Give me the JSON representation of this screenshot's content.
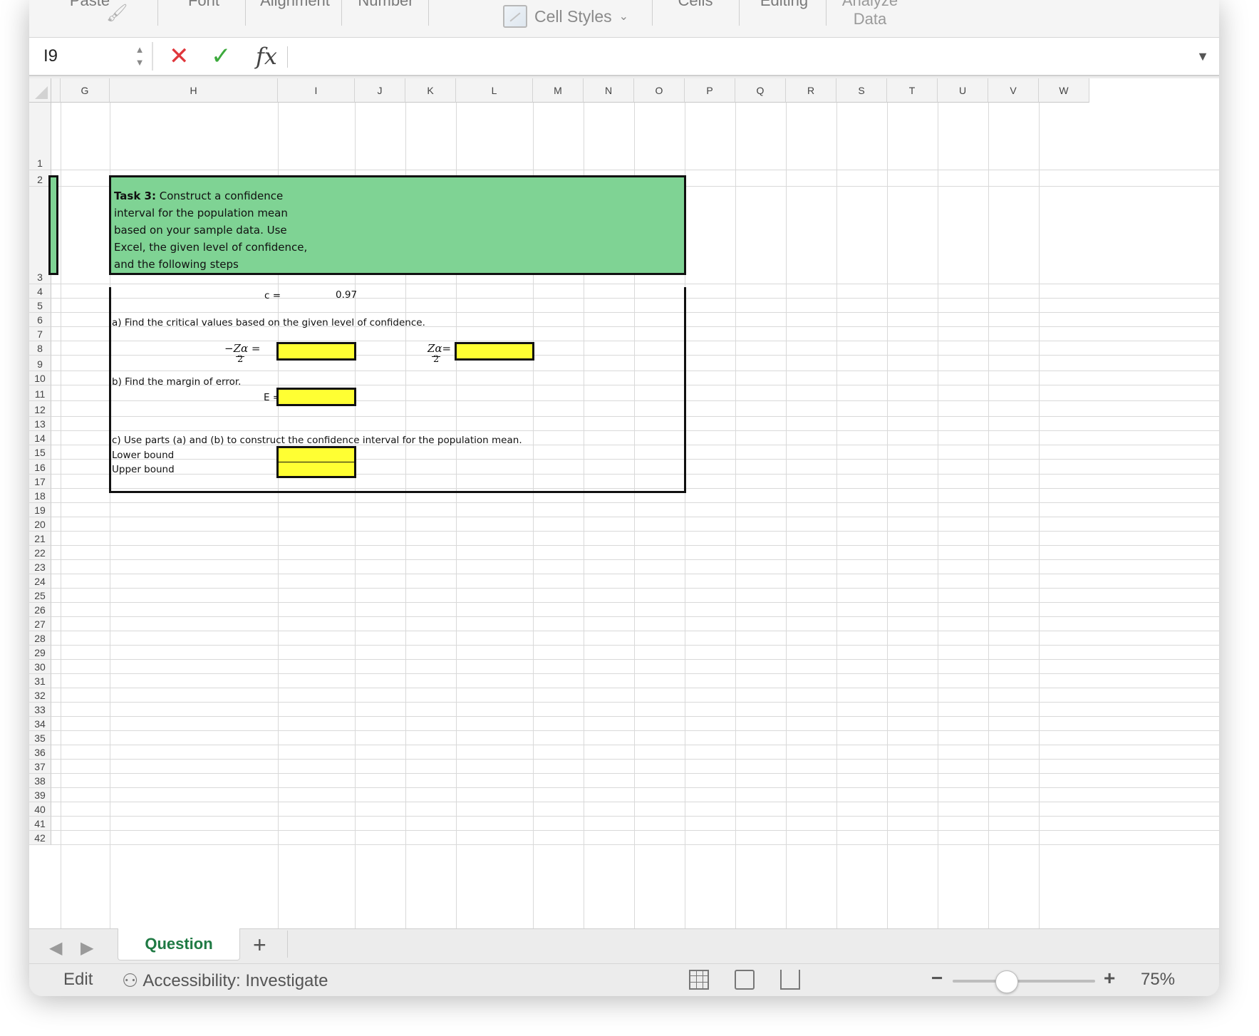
{
  "ribbon": {
    "groups": [
      "Paste",
      "Font",
      "Alignment",
      "Number",
      "Cells",
      "Editing"
    ],
    "cell_styles_label": "Cell Styles",
    "analyze_line1": "Analyze",
    "analyze_line2": "Data"
  },
  "formula_bar": {
    "name_box": "I9",
    "formula": ""
  },
  "columns": [
    "G",
    "H",
    "I",
    "J",
    "K",
    "L",
    "M",
    "N",
    "O",
    "P",
    "Q",
    "R",
    "S",
    "T",
    "U",
    "V",
    "W"
  ],
  "rows": [
    "1",
    "2",
    "3",
    "4",
    "5",
    "6",
    "7",
    "8",
    "9",
    "10",
    "11",
    "12",
    "13",
    "14",
    "15",
    "16",
    "17",
    "18",
    "19",
    "20",
    "21",
    "22",
    "23",
    "24",
    "25",
    "26",
    "27",
    "28",
    "29",
    "30",
    "31",
    "32",
    "33",
    "34",
    "35",
    "36",
    "37",
    "38",
    "39",
    "40",
    "41",
    "42"
  ],
  "sheet": {
    "task_title": "Task 3:",
    "task_lines": [
      " Construct a confidence",
      "interval for the population mean",
      "based on your sample data.  Use",
      "Excel, the given level of confidence,",
      "and the following steps"
    ],
    "c_label": "c =",
    "c_value": "0.97",
    "part_a": "a)  Find the critical values based on the given level of confidence.",
    "neg_z_label": "−Zα =",
    "pos_z_label": "Zα=",
    "frac_den": "2",
    "part_b": "b)  Find the margin of error.",
    "e_label": "E =",
    "part_c": "c)  Use parts (a) and (b) to construct the confidence interval for the population mean.",
    "lower_bound": "Lower bound",
    "upper_bound": "Upper bound"
  },
  "tabs": {
    "active": "Question",
    "add": "+"
  },
  "status": {
    "mode": "Edit",
    "accessibility": "Accessibility: Investigate",
    "zoom": "75%"
  },
  "colors": {
    "task_green": "#7fd394",
    "input_yellow": "#ffff33",
    "tab_green": "#1f7a44"
  }
}
